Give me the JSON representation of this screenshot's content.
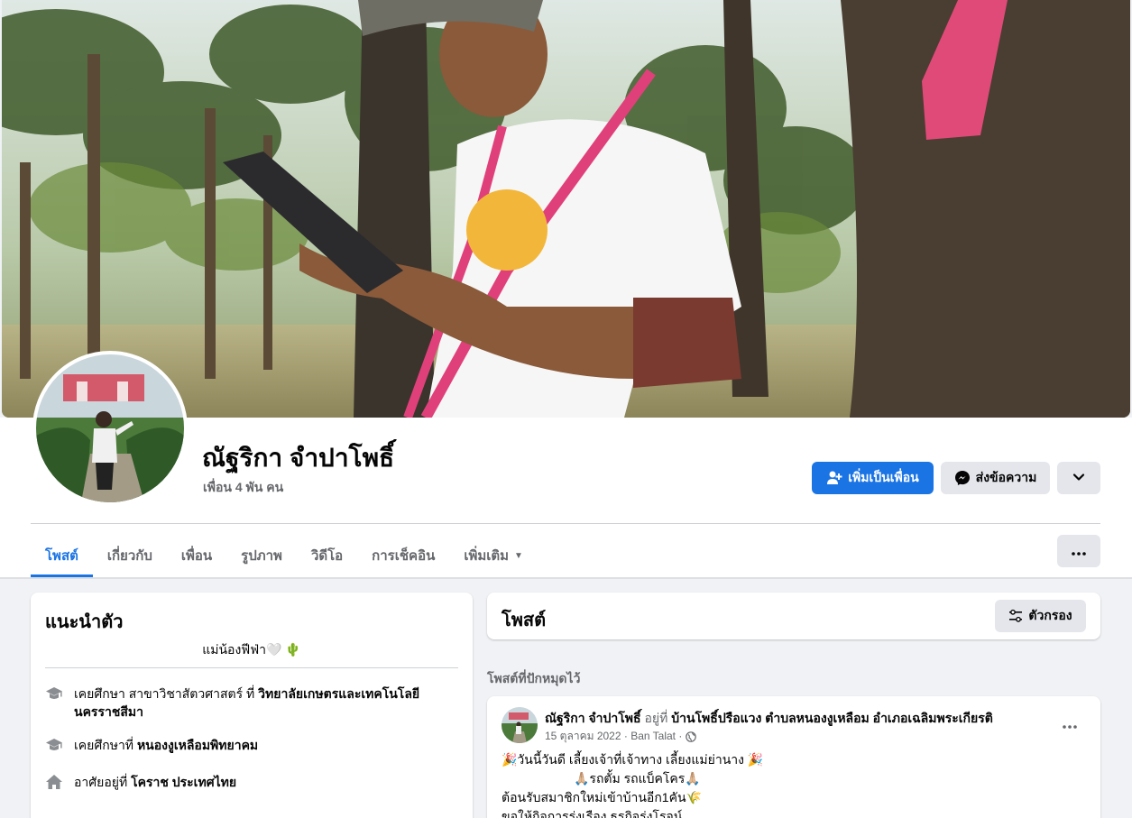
{
  "profile": {
    "name": "ณัฐริกา จำปาโพธิ์",
    "friends": "เพื่อน 4 พัน คน"
  },
  "actions": {
    "add_friend": "เพิ่มเป็นเพื่อน",
    "message": "ส่งข้อความ"
  },
  "tabs": [
    {
      "label": "โพสต์",
      "active": true
    },
    {
      "label": "เกี่ยวกับ"
    },
    {
      "label": "เพื่อน"
    },
    {
      "label": "รูปภาพ"
    },
    {
      "label": "วิดีโอ"
    },
    {
      "label": "การเช็คอิน"
    },
    {
      "label": "เพิ่มเติม"
    }
  ],
  "intro": {
    "title": "แนะนำตัว",
    "bio": "แม่น้องฟีฟ่า🤍 🌵",
    "items": [
      {
        "icon": "graduation-cap-icon",
        "prefix": "เคยศึกษา สาขาวิชาสัตวศาสตร์ ที่ ",
        "bold": "วิทยาลัยเกษตรและเทคโนโลยีนครราชสีมา"
      },
      {
        "icon": "graduation-cap-icon",
        "prefix": "เคยศึกษาที่ ",
        "bold": "หนองงูเหลือมพิทยาคม"
      },
      {
        "icon": "home-icon",
        "prefix": "อาศัยอยู่ที่ ",
        "bold": "โคราช ประเทศไทย"
      }
    ]
  },
  "posts_section": {
    "title": "โพสต์",
    "filter": "ตัวกรอง",
    "pinned_label": "โพสต์ที่ปักหมุดไว้"
  },
  "post": {
    "author": "ณัฐริกา จำปาโพธิ์",
    "at_word": "อยู่ที่",
    "location": "บ้านโพธิ์ปรือแวง ตำบลหนองงูเหลือม อำเภอเฉลิมพระเกียรติ",
    "date": "15 ตุลาคม 2022 · Ban Talat ·",
    "lines": [
      "🎉วันนี้วันดี เลี้ยงเจ้าที่เจ้าทาง เลี้ยงแม่ย่านาง 🎉",
      "🙏🏼รถตั้ม รถแบ็คโคร🙏🏼",
      "ต้อนรับสมาชิกใหม่เข้าบ้านอีก1คัน🌾",
      "ขอให้กิจการรุ่งเรือง ธุรกิจรุ่งโรจน์"
    ]
  },
  "colors": {
    "accent": "#1b74e4",
    "background": "#f0f2f5",
    "muted": "#65676b"
  }
}
